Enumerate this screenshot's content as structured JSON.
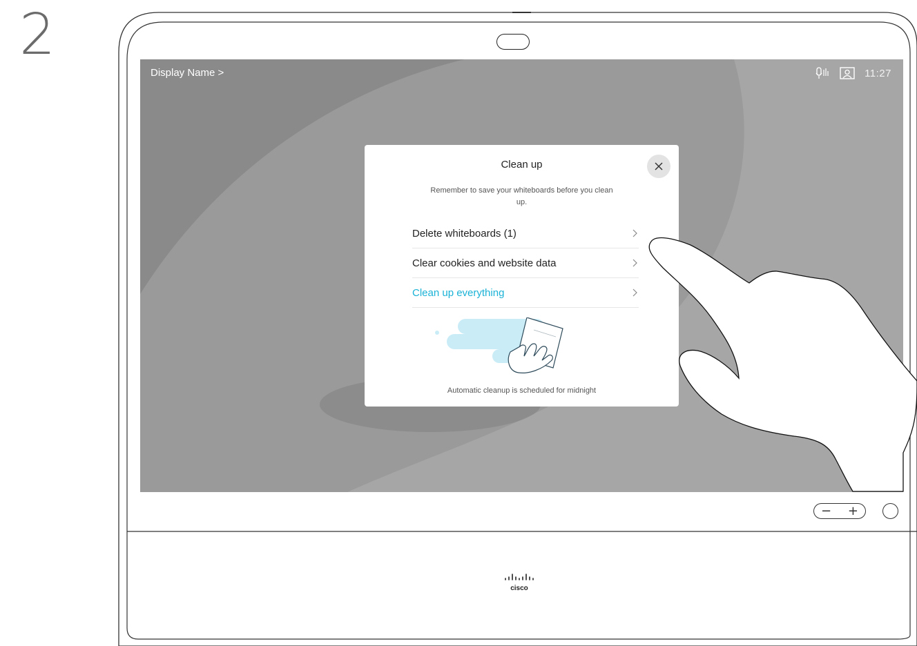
{
  "step": "2",
  "device": {
    "display_name": "Display Name >",
    "clock": "11:27",
    "status_icons": [
      "mic-activity-icon",
      "self-view-icon"
    ],
    "logo_text": "cisco"
  },
  "dialog": {
    "title": "Clean up",
    "subtitle": "Remember to save your whiteboards before you clean up.",
    "options": [
      {
        "label": "Delete whiteboards (1)",
        "accent": false
      },
      {
        "label": "Clear cookies and website data",
        "accent": false
      },
      {
        "label": "Clean up everything",
        "accent": true
      }
    ],
    "footer": "Automatic cleanup is scheduled for midnight"
  },
  "colors": {
    "accent": "#1ab2d6",
    "screen_bg": "#8d8d8d",
    "illustration_blue": "#c9ecf7"
  },
  "controls": {
    "volume_minus": "−",
    "volume_plus": "+"
  }
}
